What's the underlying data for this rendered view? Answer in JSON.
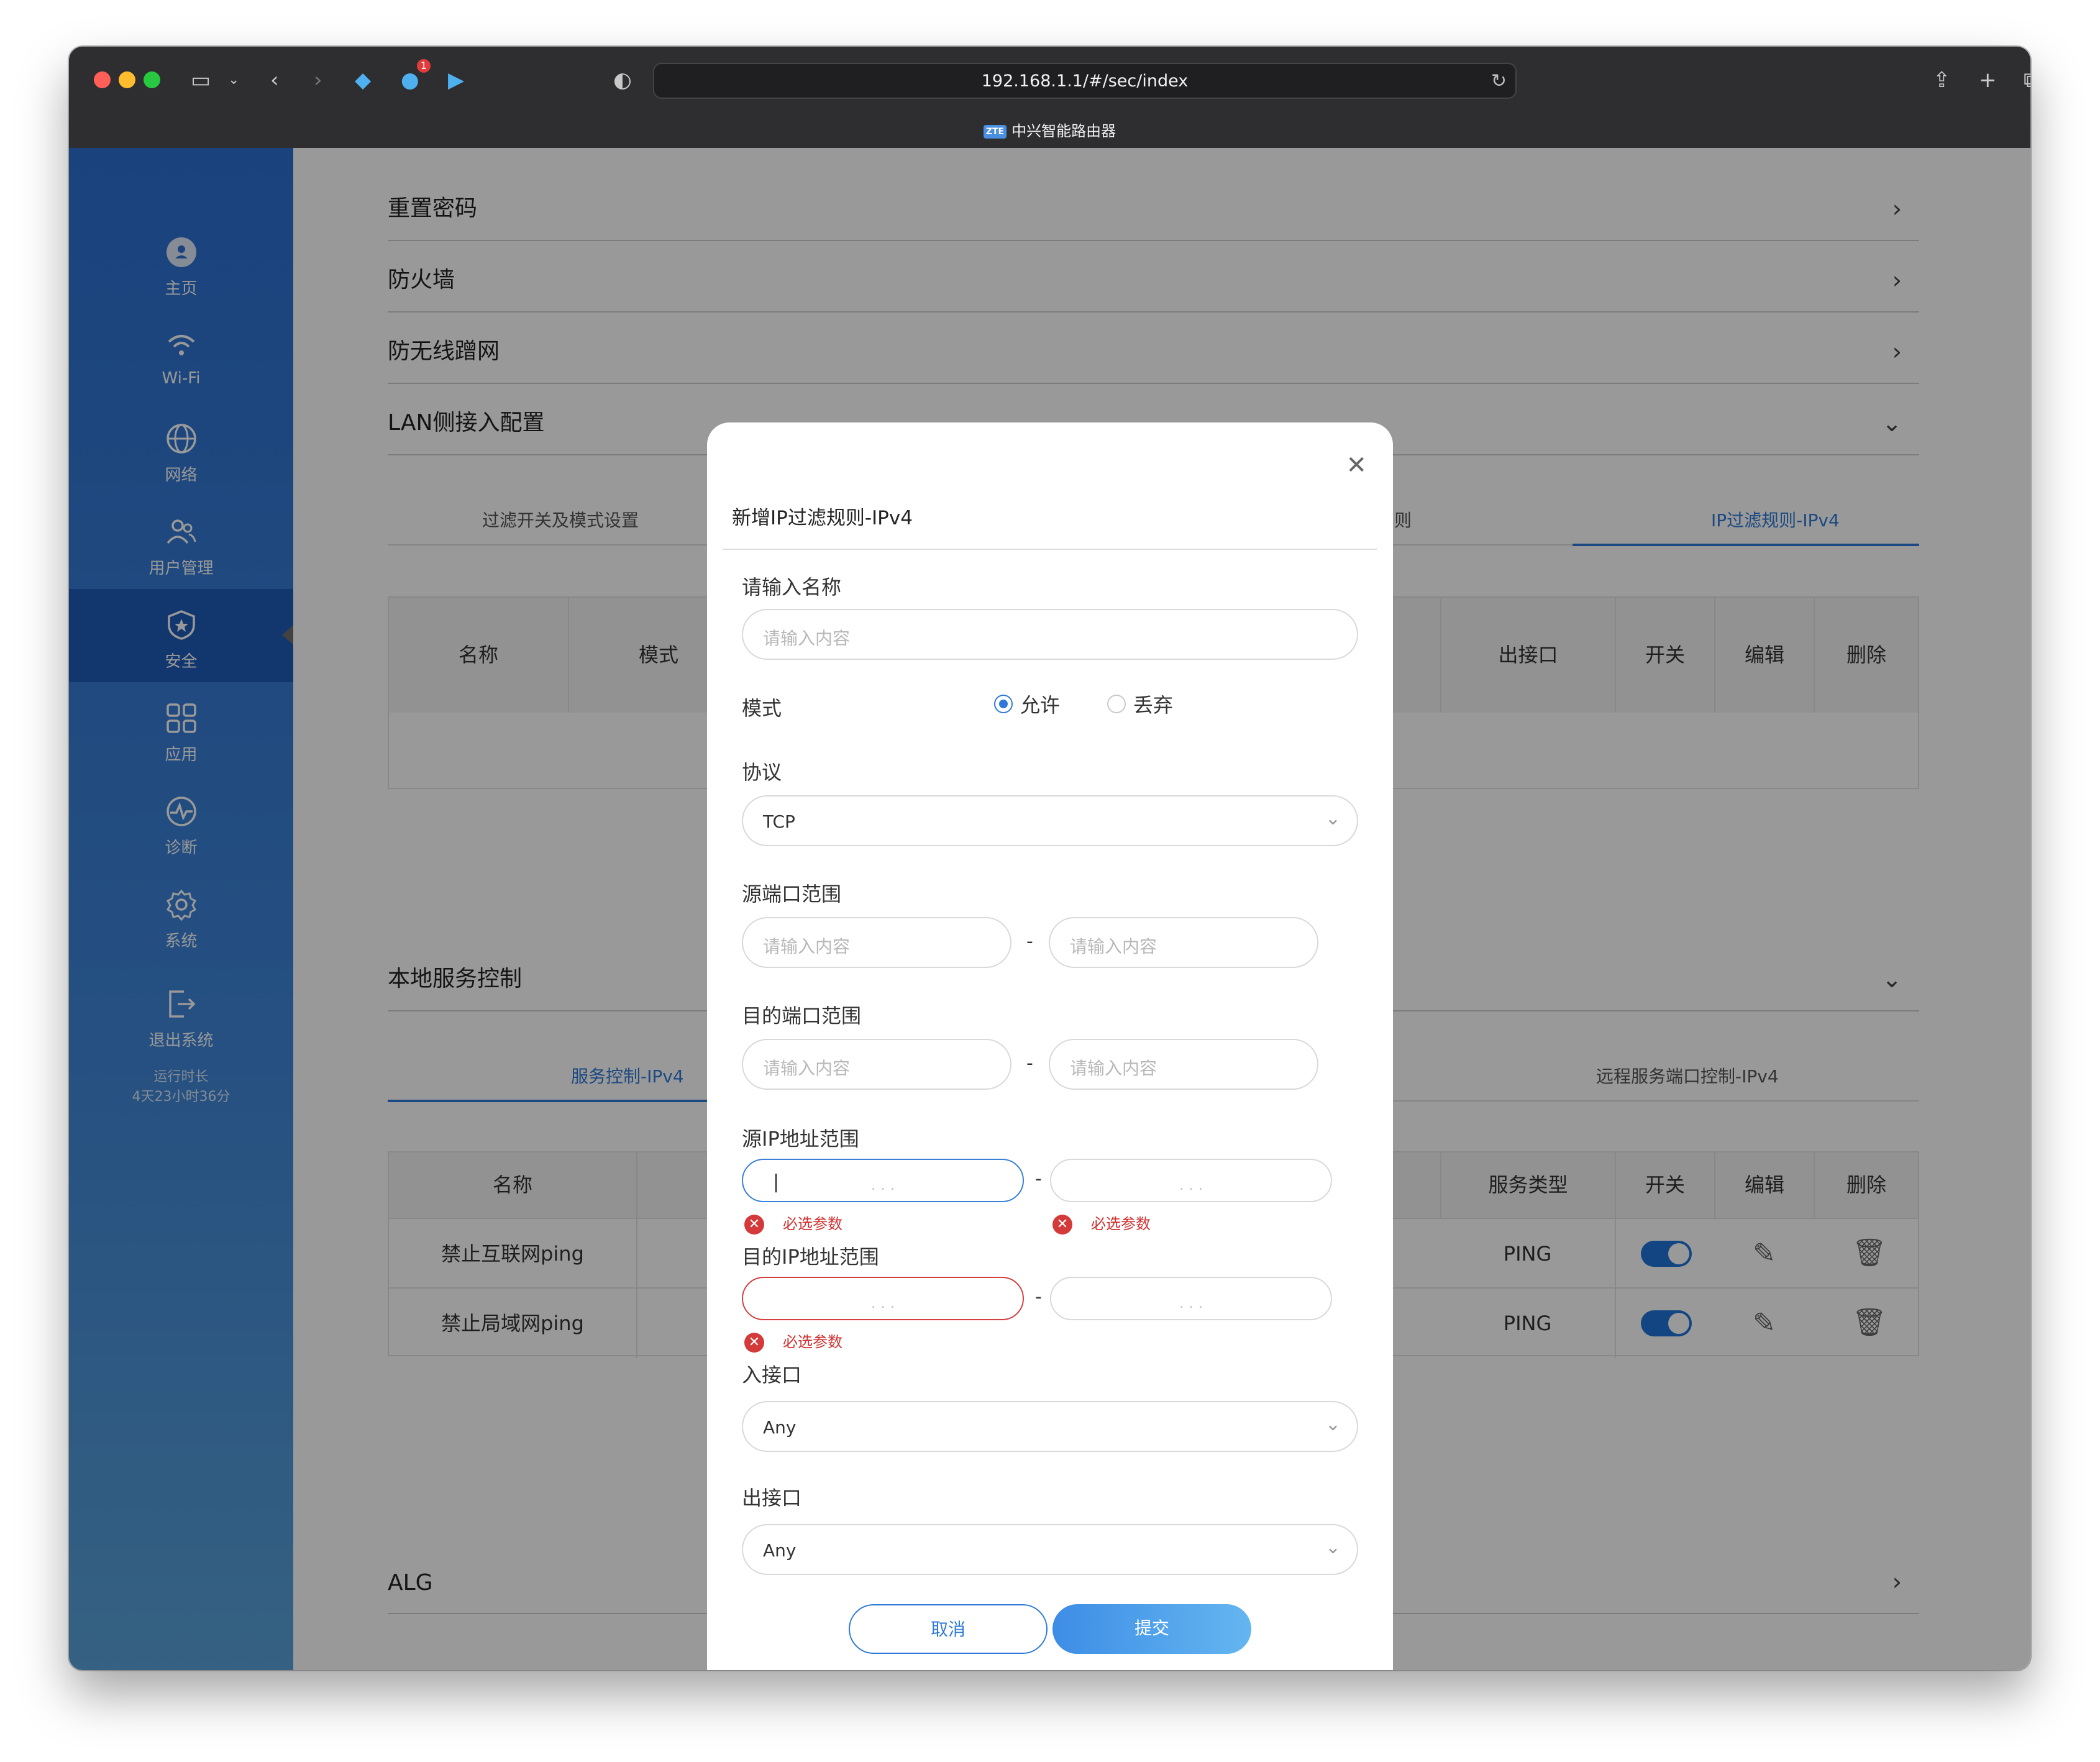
{
  "browser": {
    "url": "192.168.1.1/#/sec/index",
    "tab_title": "中兴智能路由器",
    "tab_badge": "1",
    "logo_text": "ZTE"
  },
  "sidebar": {
    "items": [
      {
        "label": "主页",
        "icon": "home-icon"
      },
      {
        "label": "Wi-Fi",
        "icon": "wifi-icon"
      },
      {
        "label": "网络",
        "icon": "globe-icon"
      },
      {
        "label": "用户管理",
        "icon": "users-icon"
      },
      {
        "label": "安全",
        "icon": "shield-icon"
      },
      {
        "label": "应用",
        "icon": "apps-icon"
      },
      {
        "label": "诊断",
        "icon": "diagnose-icon"
      },
      {
        "label": "系统",
        "icon": "gear-icon"
      },
      {
        "label": "退出系统",
        "icon": "logout-icon"
      }
    ],
    "runtime_label": "运行时长",
    "runtime_value": "4天23小时36分"
  },
  "sections": {
    "reset_password": "重置密码",
    "firewall": "防火墙",
    "anti_freeload": "防无线蹭网",
    "lan_access": "LAN侧接入配置",
    "local_service": "本地服务控制",
    "alg": "ALG"
  },
  "lan_tabs": {
    "filter_switch": "过滤开关及模式设置",
    "partial_hidden": "则",
    "ip_filter_v4": "IP过滤规则-IPv4"
  },
  "lan_table": {
    "headers": {
      "name": "名称",
      "mode": "模式",
      "out_if": "出接口",
      "switch": "开关",
      "edit": "编辑",
      "delete": "删除"
    }
  },
  "service_tabs": {
    "service_ctrl": "服务控制-IPv4",
    "remote_port": "远程服务端口控制-IPv4"
  },
  "service_table": {
    "headers": {
      "name": "名称",
      "service_type": "服务类型",
      "switch": "开关",
      "edit": "编辑",
      "delete": "删除"
    },
    "rows": [
      {
        "name": "禁止互联网ping",
        "service_type": "PING",
        "enabled": true
      },
      {
        "name": "禁止局域网ping",
        "service_type": "PING",
        "enabled": true
      }
    ]
  },
  "modal": {
    "title": "新增IP过滤规则-IPv4",
    "name_label": "请输入名称",
    "name_placeholder": "请输入内容",
    "mode_label": "模式",
    "mode_allow": "允许",
    "mode_drop": "丢弃",
    "mode_selected": "允许",
    "protocol_label": "协议",
    "protocol_value": "TCP",
    "src_port_label": "源端口范围",
    "dst_port_label": "目的端口范围",
    "port_placeholder": "请输入内容",
    "range_sep": "-",
    "src_ip_label": "源IP地址范围",
    "dst_ip_label": "目的IP地址范围",
    "ip_dots": ".          .          .",
    "required_msg": "必选参数",
    "in_if_label": "入接口",
    "in_if_value": "Any",
    "out_if_label": "出接口",
    "out_if_value": "Any",
    "cancel": "取消",
    "submit": "提交"
  }
}
